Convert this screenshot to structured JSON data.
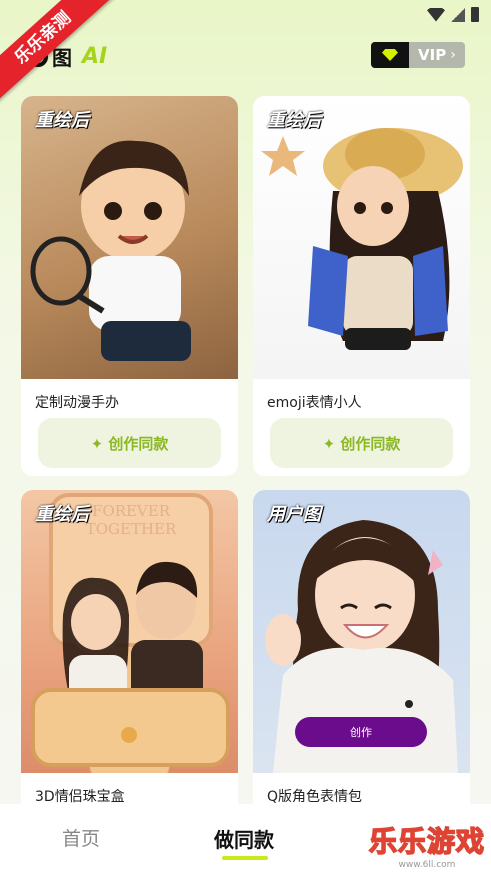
{
  "ribbon": {
    "text": "乐乐亲测"
  },
  "header": {
    "logo_text": "图",
    "logo_ai": "AI",
    "vip_label": "VIP",
    "vip_chevron": "›"
  },
  "cards": [
    {
      "tag": "重绘后",
      "title": "定制动漫手办",
      "button": "✦ 创作同款"
    },
    {
      "tag": "重绘后",
      "title": "emoji表情小人",
      "button": "✦ 创作同款"
    },
    {
      "tag": "重绘后",
      "title": "3D情侣珠宝盒",
      "overlay_text_1": "FOREVER",
      "overlay_text_2": "TOGETHER"
    },
    {
      "tag": "用户图",
      "title": "Q版角色表情包",
      "create_pill": "创作"
    }
  ],
  "tabs": [
    {
      "label": "首页"
    },
    {
      "label": "做同款"
    }
  ],
  "watermark": {
    "main": "乐乐游戏",
    "sub": "www.6ll.com"
  },
  "colors": {
    "accent": "#c7ea1a",
    "button_text": "#8bb822",
    "ribbon": "#e4232b",
    "create_pill": "#6a0c8c"
  }
}
